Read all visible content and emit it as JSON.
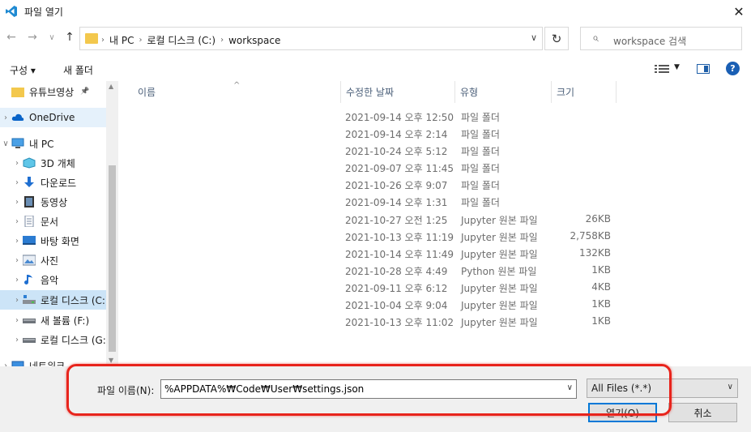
{
  "window": {
    "title": "파일 열기",
    "close_glyph": "✕",
    "app_icon": "vscode-icon",
    "accent_color": "#0078d7"
  },
  "address": {
    "back_glyph": "←",
    "forward_glyph": "→",
    "recent_glyph": "∨",
    "up_glyph": "↑",
    "crumbs": [
      "내 PC",
      "로컬 디스크 (C:)",
      "workspace"
    ],
    "crumb_sep": "›",
    "dropdown_glyph": "∨",
    "refresh_glyph": "↻",
    "search_placeholder": "workspace 검색",
    "search_glyph": "⌕"
  },
  "toolbar": {
    "organize_label": "구성 ▾",
    "new_folder_label": "새 폴더",
    "view_dropdown_glyph": "▼",
    "help_glyph": "?"
  },
  "nav": {
    "items": [
      {
        "label": "유튜브영상",
        "icon": "folder-icon",
        "pinned": true,
        "chev": ""
      },
      {
        "label": "OneDrive",
        "icon": "onedrive-icon",
        "chev": "›"
      },
      {
        "label": "내 PC",
        "icon": "pc-icon",
        "chev": "∨"
      },
      {
        "label": "3D 개체",
        "icon": "3d-objects-icon",
        "chev": "›"
      },
      {
        "label": "다운로드",
        "icon": "downloads-icon",
        "chev": "›"
      },
      {
        "label": "동영상",
        "icon": "videos-icon",
        "chev": "›"
      },
      {
        "label": "문서",
        "icon": "documents-icon",
        "chev": "›"
      },
      {
        "label": "바탕 화면",
        "icon": "desktop-icon",
        "chev": "›"
      },
      {
        "label": "사진",
        "icon": "pictures-icon",
        "chev": "›"
      },
      {
        "label": "음악",
        "icon": "music-icon",
        "chev": "›"
      },
      {
        "label": "로컬 디스크 (C:)",
        "icon": "local-disk-icon",
        "chev": "›"
      },
      {
        "label": "새 볼륨 (F:)",
        "icon": "drive-icon",
        "chev": "›"
      },
      {
        "label": "로컬 디스크 (G:)",
        "icon": "drive-icon",
        "chev": "›"
      },
      {
        "label": "네트워크",
        "icon": "network-icon",
        "chev": "›"
      }
    ],
    "pin_glyph": "📌"
  },
  "columns": {
    "name": "이름",
    "date": "수정한 날짜",
    "type": "유형",
    "size": "크기",
    "sort_glyph": "^"
  },
  "files": [
    {
      "date": "2021-09-14 오후 12:50",
      "type": "파일 폴더",
      "size": ""
    },
    {
      "date": "2021-09-14 오후 2:14",
      "type": "파일 폴더",
      "size": ""
    },
    {
      "date": "2021-10-24 오후 5:12",
      "type": "파일 폴더",
      "size": ""
    },
    {
      "date": "2021-09-07 오후 11:45",
      "type": "파일 폴더",
      "size": ""
    },
    {
      "date": "2021-10-26 오후 9:07",
      "type": "파일 폴더",
      "size": ""
    },
    {
      "date": "2021-09-14 오후 1:31",
      "type": "파일 폴더",
      "size": ""
    },
    {
      "date": "2021-10-27 오전 1:25",
      "type": "Jupyter 원본 파일",
      "size": "26KB"
    },
    {
      "date": "2021-10-13 오후 11:19",
      "type": "Jupyter 원본 파일",
      "size": "2,758KB"
    },
    {
      "date": "2021-10-14 오후 11:49",
      "type": "Jupyter 원본 파일",
      "size": "132KB"
    },
    {
      "date": "2021-10-28 오후 4:49",
      "type": "Python 원본 파일",
      "size": "1KB"
    },
    {
      "date": "2021-09-11 오후 6:12",
      "type": "Jupyter 원본 파일",
      "size": "4KB"
    },
    {
      "date": "2021-10-04 오후 9:04",
      "type": "Jupyter 원본 파일",
      "size": "1KB"
    },
    {
      "date": "2021-10-13 오후 11:02",
      "type": "Jupyter 원본 파일",
      "size": "1KB"
    }
  ],
  "bottom": {
    "filename_label": "파일 이름(N):",
    "filename_value": "%APPDATA%₩Code₩User₩settings.json",
    "filename_dropdown_glyph": "∨",
    "filetype_value": "All Files (*.*)",
    "filetype_dropdown_glyph": "∨",
    "open_label": "열기(O)",
    "cancel_label": "취소",
    "highlight_color": "#e8241c"
  }
}
